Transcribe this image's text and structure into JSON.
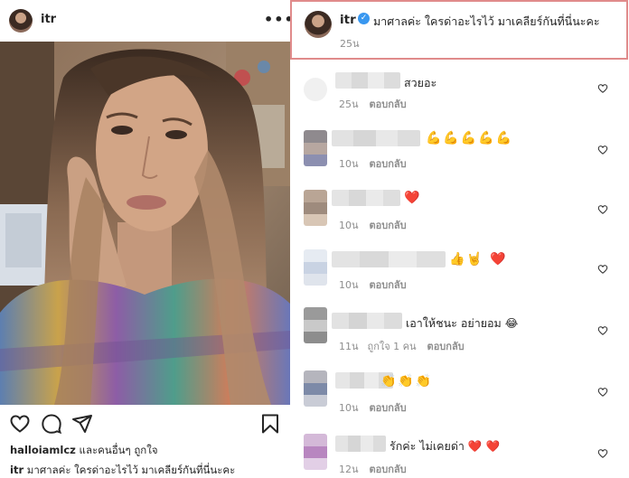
{
  "post": {
    "username": "itr",
    "more_label": "•••",
    "liked_by_user": "halloiamlcz",
    "liked_by_rest": " และคนอื่นๆ ถูกใจ",
    "caption_user": "itr",
    "caption_text": " มาศาลค่ะ  ใครด่าอะไรไว้ มาเคลียร์กันที่นี่นะคะ"
  },
  "highlighted_comment": {
    "username": "itr",
    "verified_mark": "✓",
    "text": "มาศาลค่ะ  ใครด่าอะไรไว้ มาเคลียร์กันที่นี่นะคะ",
    "time": "25น",
    "border_color": "#e08b8b"
  },
  "comments": [
    {
      "text": "สวยอะ",
      "time": "25น",
      "likes": "",
      "reply": "ตอบกลับ"
    },
    {
      "text": "💪💪💪💪💪",
      "time": "10น",
      "likes": "",
      "reply": "ตอบกลับ"
    },
    {
      "text": "❤️",
      "time": "10น",
      "likes": "",
      "reply": "ตอบกลับ"
    },
    {
      "text": "👍🤘 ❤️",
      "time": "10น",
      "likes": "",
      "reply": "ตอบกลับ"
    },
    {
      "text": "เอาให้ชนะ อย่ายอม 😂",
      "time": "11น",
      "likes": "ถูกใจ 1 คน",
      "reply": "ตอบกลับ"
    },
    {
      "text": "👏👏👏",
      "time": "10น",
      "likes": "",
      "reply": "ตอบกลับ"
    },
    {
      "text": "รักค่ะ ไม่เคยด่า ❤️ ❤️",
      "time": "12น",
      "likes": "",
      "reply": "ตอบกลับ"
    }
  ],
  "icons": {
    "like": "heart-icon",
    "comment": "comment-icon",
    "share": "share-icon",
    "save": "bookmark-icon"
  },
  "colors": {
    "verified_blue": "#3897f0",
    "muted_text": "#8e8e8e",
    "text": "#262626"
  }
}
